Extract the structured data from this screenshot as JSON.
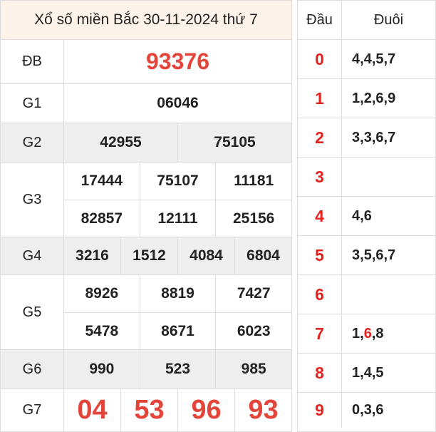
{
  "title": "Xổ số miền Bắc 30-11-2024 thứ 7",
  "prizes": {
    "db": {
      "label": "ĐB",
      "numbers": [
        "93376"
      ]
    },
    "g1": {
      "label": "G1",
      "numbers": [
        "06046"
      ]
    },
    "g2": {
      "label": "G2",
      "numbers": [
        "42955",
        "75105"
      ]
    },
    "g3": {
      "label": "G3",
      "numbers": [
        "17444",
        "75107",
        "11181",
        "82857",
        "12111",
        "25156"
      ]
    },
    "g4": {
      "label": "G4",
      "numbers": [
        "3216",
        "1512",
        "4084",
        "6804"
      ]
    },
    "g5": {
      "label": "G5",
      "numbers": [
        "8926",
        "8819",
        "7427",
        "5478",
        "8671",
        "6023"
      ]
    },
    "g6": {
      "label": "G6",
      "numbers": [
        "990",
        "523",
        "985"
      ]
    },
    "g7": {
      "label": "G7",
      "numbers": [
        "04",
        "53",
        "96",
        "93"
      ]
    }
  },
  "loto": {
    "head_label": "Đầu",
    "tail_label": "Đuôi",
    "rows": [
      {
        "head": "0",
        "tails": [
          "4",
          "4",
          "5",
          "7"
        ],
        "highlight": []
      },
      {
        "head": "1",
        "tails": [
          "1",
          "2",
          "6",
          "9"
        ],
        "highlight": []
      },
      {
        "head": "2",
        "tails": [
          "3",
          "3",
          "6",
          "7"
        ],
        "highlight": []
      },
      {
        "head": "3",
        "tails": [],
        "highlight": []
      },
      {
        "head": "4",
        "tails": [
          "4",
          "6"
        ],
        "highlight": []
      },
      {
        "head": "5",
        "tails": [
          "3",
          "5",
          "6",
          "7"
        ],
        "highlight": []
      },
      {
        "head": "6",
        "tails": [],
        "highlight": []
      },
      {
        "head": "7",
        "tails": [
          "1",
          "6",
          "8"
        ],
        "highlight": [
          1
        ]
      },
      {
        "head": "8",
        "tails": [
          "1",
          "4",
          "5"
        ],
        "highlight": []
      },
      {
        "head": "9",
        "tails": [
          "0",
          "3",
          "6"
        ],
        "highlight": []
      }
    ]
  },
  "colors": {
    "special": "#e4453b",
    "head_digit": "#e4211c",
    "title_bg": "#fdf3ea",
    "shade_bg": "#eeeeee"
  }
}
